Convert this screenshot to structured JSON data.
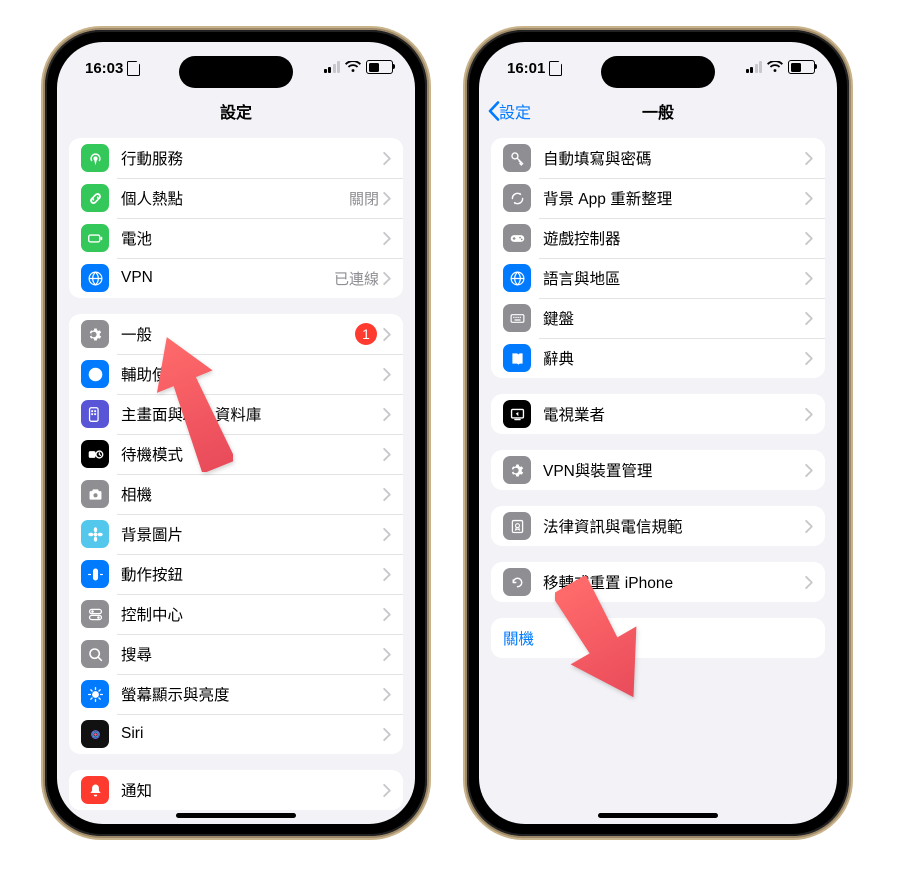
{
  "left": {
    "status": {
      "time": "16:03"
    },
    "nav": {
      "title": "設定"
    },
    "group1": [
      {
        "icon": "antenna-icon",
        "color": "#34c759",
        "label": "行動服務"
      },
      {
        "icon": "link-icon",
        "color": "#34c759",
        "label": "個人熱點",
        "detail": "關閉"
      },
      {
        "icon": "battery-icon",
        "color": "#34c759",
        "label": "電池"
      },
      {
        "icon": "globe-icon",
        "color": "#007aff",
        "label": "VPN",
        "detail": "已連線"
      }
    ],
    "group2": [
      {
        "icon": "gear-icon",
        "color": "#8e8e93",
        "label": "一般",
        "badge": "1"
      },
      {
        "icon": "accessibility-icon",
        "color": "#007aff",
        "label": "輔助使用"
      },
      {
        "icon": "apps-icon",
        "color": "#5856d6",
        "label": "主畫面與App 資料庫"
      },
      {
        "icon": "standby-icon",
        "color": "#000000",
        "label": "待機模式"
      },
      {
        "icon": "camera-icon",
        "color": "#8e8e93",
        "label": "相機"
      },
      {
        "icon": "flower-icon",
        "color": "#54c7ec",
        "label": "背景圖片"
      },
      {
        "icon": "action-icon",
        "color": "#007aff",
        "label": "動作按鈕"
      },
      {
        "icon": "switches-icon",
        "color": "#8e8e93",
        "label": "控制中心"
      },
      {
        "icon": "search-icon",
        "color": "#8e8e93",
        "label": "搜尋"
      },
      {
        "icon": "display-icon",
        "color": "#007aff",
        "label": "螢幕顯示與亮度"
      },
      {
        "icon": "siri-icon",
        "color": "#111111",
        "label": "Siri"
      }
    ],
    "group3": [
      {
        "icon": "bell-icon",
        "color": "#ff3b30",
        "label": "通知"
      }
    ]
  },
  "right": {
    "status": {
      "time": "16:01"
    },
    "nav": {
      "back": "設定",
      "title": "一般"
    },
    "group1": [
      {
        "icon": "key-icon",
        "color": "#8e8e93",
        "label": "自動填寫與密碼"
      },
      {
        "icon": "refresh-icon",
        "color": "#8e8e93",
        "label": "背景 App 重新整理"
      },
      {
        "icon": "gamepad-icon",
        "color": "#8e8e93",
        "label": "遊戲控制器"
      },
      {
        "icon": "globe-icon",
        "color": "#007aff",
        "label": "語言與地區"
      },
      {
        "icon": "keyboard-icon",
        "color": "#8e8e93",
        "label": "鍵盤"
      },
      {
        "icon": "book-icon",
        "color": "#007aff",
        "label": "辭典"
      }
    ],
    "group2": [
      {
        "icon": "tv-icon",
        "color": "#000000",
        "label": "電視業者"
      }
    ],
    "group3": [
      {
        "icon": "gear-icon",
        "color": "#8e8e93",
        "label": "VPN與裝置管理"
      }
    ],
    "group4": [
      {
        "icon": "cert-icon",
        "color": "#8e8e93",
        "label": "法律資訊與電信規範"
      }
    ],
    "group5": [
      {
        "icon": "reset-icon",
        "color": "#8e8e93",
        "label": "移轉或重置 iPhone"
      }
    ],
    "shutdown": "關機"
  }
}
